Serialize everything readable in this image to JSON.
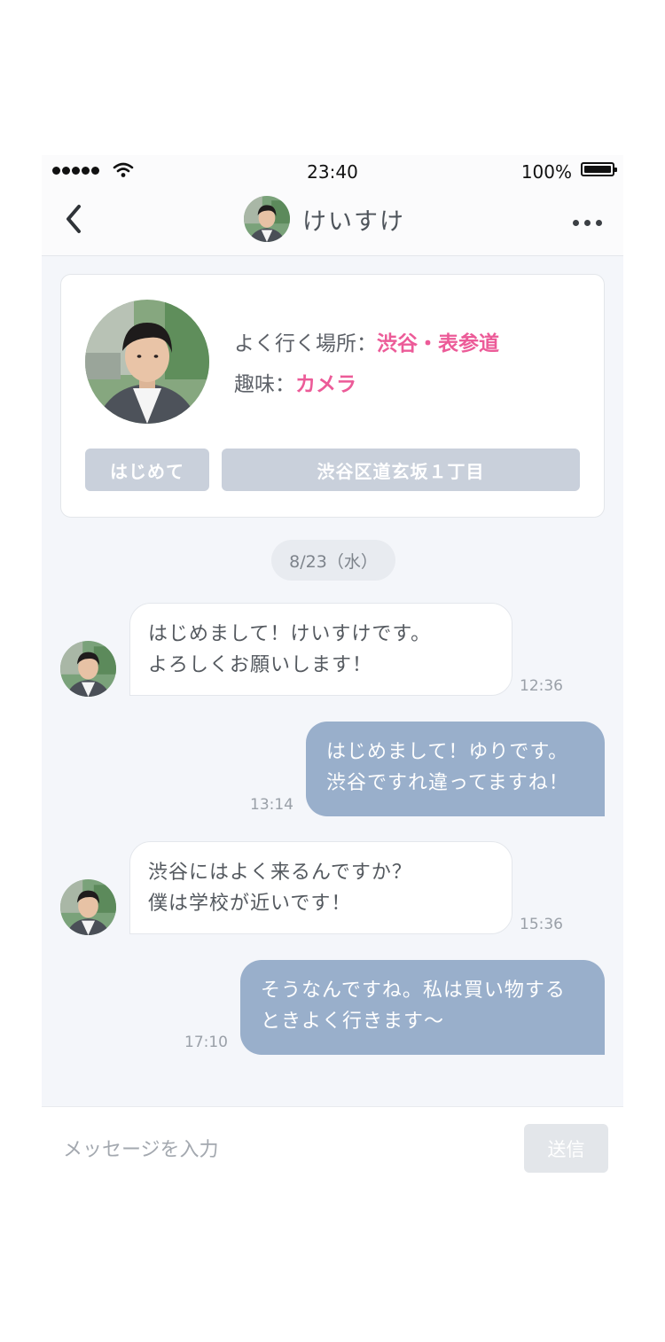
{
  "status_bar": {
    "time": "23:40",
    "battery": "100%"
  },
  "header": {
    "name": "けいすけ"
  },
  "profile": {
    "place_label": "よく行く場所：",
    "place_value": "渋谷・表参道",
    "hobby_label": "趣味：",
    "hobby_value": "カメラ",
    "tags": [
      "はじめて",
      "渋谷区道玄坂１丁目"
    ]
  },
  "date_divider": "8/23（水）",
  "messages": [
    {
      "from": "other",
      "lines": [
        "はじめまして！けいすけです。",
        "よろしくお願いします！"
      ],
      "time": "12:36"
    },
    {
      "from": "me",
      "lines": [
        "はじめまして！ゆりです。",
        "渋谷ですれ違ってますね！"
      ],
      "time": "13:14"
    },
    {
      "from": "other",
      "lines": [
        "渋谷にはよく来るんですか？",
        "僕は学校が近いです！"
      ],
      "time": "15:36"
    },
    {
      "from": "me",
      "lines": [
        "そうなんですね。私は買い物する",
        "ときよく行きます〜"
      ],
      "time": "17:10"
    }
  ],
  "composer": {
    "placeholder": "メッセージを入力",
    "send_label": "送信"
  },
  "colors": {
    "accent": "#ec5b98",
    "outgoing_bubble": "#99afcb",
    "tag": "#c9d0db"
  }
}
